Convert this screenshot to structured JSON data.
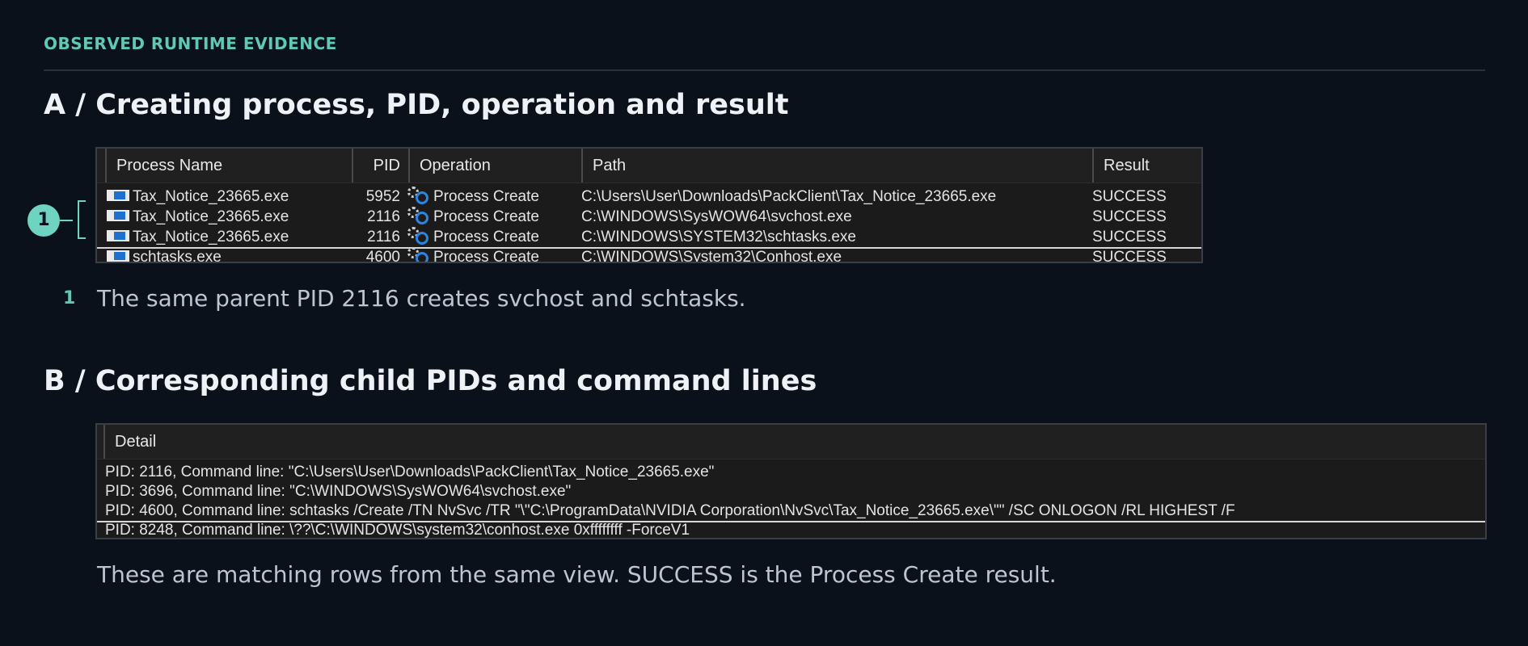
{
  "kicker": "OBSERVED RUNTIME EVIDENCE",
  "section_a": {
    "heading": "A / Creating process, PID, operation and result",
    "columns": [
      "Process Name",
      "PID",
      "Operation",
      "Path",
      "Result"
    ],
    "rows": [
      {
        "process": "Tax_Notice_23665.exe",
        "pid": "5952",
        "operation": "Process Create",
        "path": "C:\\Users\\User\\Downloads\\PackClient\\Tax_Notice_23665.exe",
        "result": "SUCCESS"
      },
      {
        "process": "Tax_Notice_23665.exe",
        "pid": "2116",
        "operation": "Process Create",
        "path": "C:\\WINDOWS\\SysWOW64\\svchost.exe",
        "result": "SUCCESS"
      },
      {
        "process": "Tax_Notice_23665.exe",
        "pid": "2116",
        "operation": "Process Create",
        "path": "C:\\WINDOWS\\SYSTEM32\\schtasks.exe",
        "result": "SUCCESS"
      },
      {
        "process": "schtasks.exe",
        "pid": "4600",
        "operation": "Process Create",
        "path": "C:\\WINDOWS\\System32\\Conhost.exe",
        "result": "SUCCESS"
      }
    ],
    "callout_number": "1",
    "note_number": "1",
    "note_text": "The same parent PID 2116 creates svchost and schtasks."
  },
  "section_b": {
    "heading": "B / Corresponding child PIDs and command lines",
    "column": "Detail",
    "rows": [
      "PID: 2116, Command line: \"C:\\Users\\User\\Downloads\\PackClient\\Tax_Notice_23665.exe\"",
      "PID: 3696, Command line: \"C:\\WINDOWS\\SysWOW64\\svchost.exe\"",
      "PID: 4600, Command line: schtasks /Create /TN NvSvc /TR \"\\\"C:\\ProgramData\\NVIDIA Corporation\\NvSvc\\Tax_Notice_23665.exe\\\"\" /SC ONLOGON /RL HIGHEST /F",
      "PID: 8248, Command line: \\??\\C:\\WINDOWS\\system32\\conhost.exe 0xffffffff -ForceV1"
    ],
    "caption": "These are matching rows from the same view. SUCCESS is the Process Create result."
  }
}
